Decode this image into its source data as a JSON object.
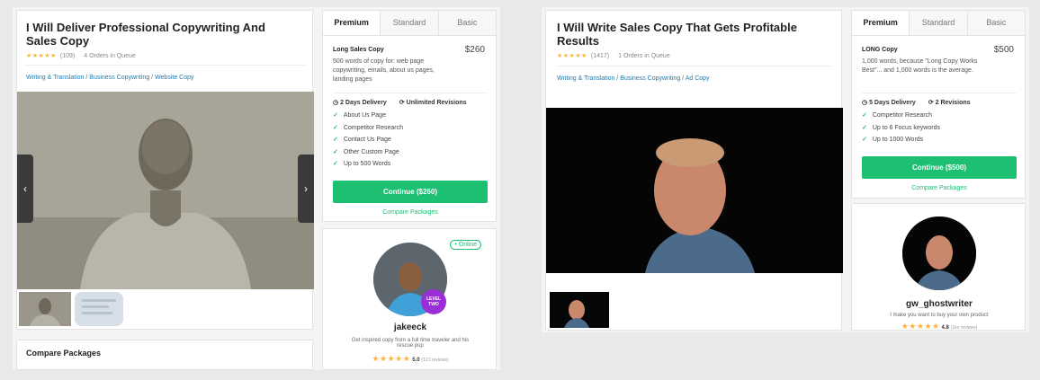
{
  "left": {
    "gig": {
      "title": "I Will Deliver Professional Copywriting And Sales Copy",
      "stars": "★★★★★",
      "rating_count": "(109)",
      "queue": "4 Orders in Queue",
      "breadcrumb": [
        "Writing & Translation",
        "Business Copywriting",
        "Website Copy"
      ],
      "compare_label": "Compare Packages"
    },
    "tabs": [
      "Premium",
      "Standard",
      "Basic"
    ],
    "package": {
      "name": "Long Sales Copy",
      "price": "$260",
      "description": "500 words of copy for: web page copywriting, emails, about us pages, landing pages",
      "delivery": "2 Days Delivery",
      "revisions": "Unlimited Revisions",
      "features": [
        "About Us Page",
        "Competitor Research",
        "Contact Us Page",
        "Other Custom Page",
        "Up to 500 Words"
      ],
      "cta": "Continue ($260)",
      "compare_link": "Compare Packages"
    },
    "seller": {
      "online": "• Online",
      "level_line1": "LEVEL",
      "level_line2": "TWO",
      "username": "jakeeck",
      "tagline": "Get inspired copy from a full time traveler and his rescue pup",
      "stars": "★★★★★",
      "rating": "5.0",
      "reviews": "(121 reviews)"
    },
    "nav_prev": "‹",
    "nav_next": "›"
  },
  "right": {
    "gig": {
      "title": "I Will Write Sales Copy That Gets Profitable Results",
      "stars": "★★★★★",
      "rating_count": "(1417)",
      "queue": "1 Orders in Queue",
      "breadcrumb": [
        "Writing & Translation",
        "Business Copywriting",
        "Ad Copy"
      ]
    },
    "tabs": [
      "Premium",
      "Standard",
      "Basic"
    ],
    "package": {
      "name": "LONG Copy",
      "price": "$500",
      "description": "1,000 words, because \"Long Copy Works Best\"... and 1,000 words is the average.",
      "delivery": "5 Days Delivery",
      "revisions": "2 Revisions",
      "features": [
        "Competitor Research",
        "Up to 6 Focus keywords",
        "Up to 1000 Words"
      ],
      "cta": "Continue ($500)",
      "compare_link": "Compare Packages"
    },
    "seller": {
      "username": "gw_ghostwriter",
      "tagline": "I make you want to buy your own product",
      "stars": "★★★★★",
      "rating": "4.8",
      "reviews": "(1ks reviews)"
    }
  },
  "colors": {
    "accent": "#1dbf73",
    "star": "#ffb33e",
    "link": "#1d7bb0",
    "level": "#9b2fd6"
  }
}
